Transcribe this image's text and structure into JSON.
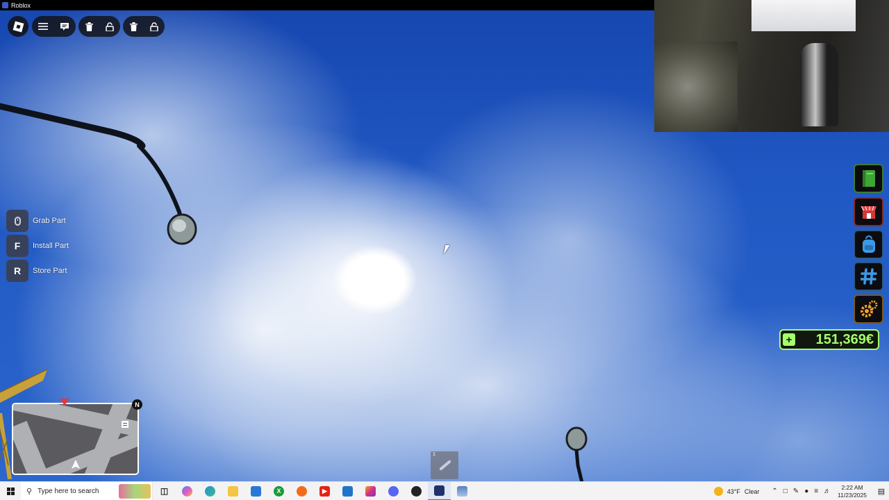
{
  "window": {
    "title": "Roblox"
  },
  "controls": [
    {
      "key": "",
      "label": "Grab Part",
      "icon": "mouse-icon"
    },
    {
      "key": "F",
      "label": "Install Part"
    },
    {
      "key": "R",
      "label": "Store Part"
    }
  ],
  "money": {
    "amount": "151,369€",
    "add_label": "+"
  },
  "minimap": {
    "compass": "N"
  },
  "hotbar": {
    "slot_number": "1"
  },
  "taskbar": {
    "search_placeholder": "Type here to search",
    "weather_temp": "43°F",
    "weather_desc": "Clear",
    "time": "2:22 AM",
    "date": "11/23/2025"
  },
  "colors": {
    "money_accent": "#a6ff6a",
    "sky": "#1d4fb8",
    "side_button_border": "#6a2d2d"
  }
}
